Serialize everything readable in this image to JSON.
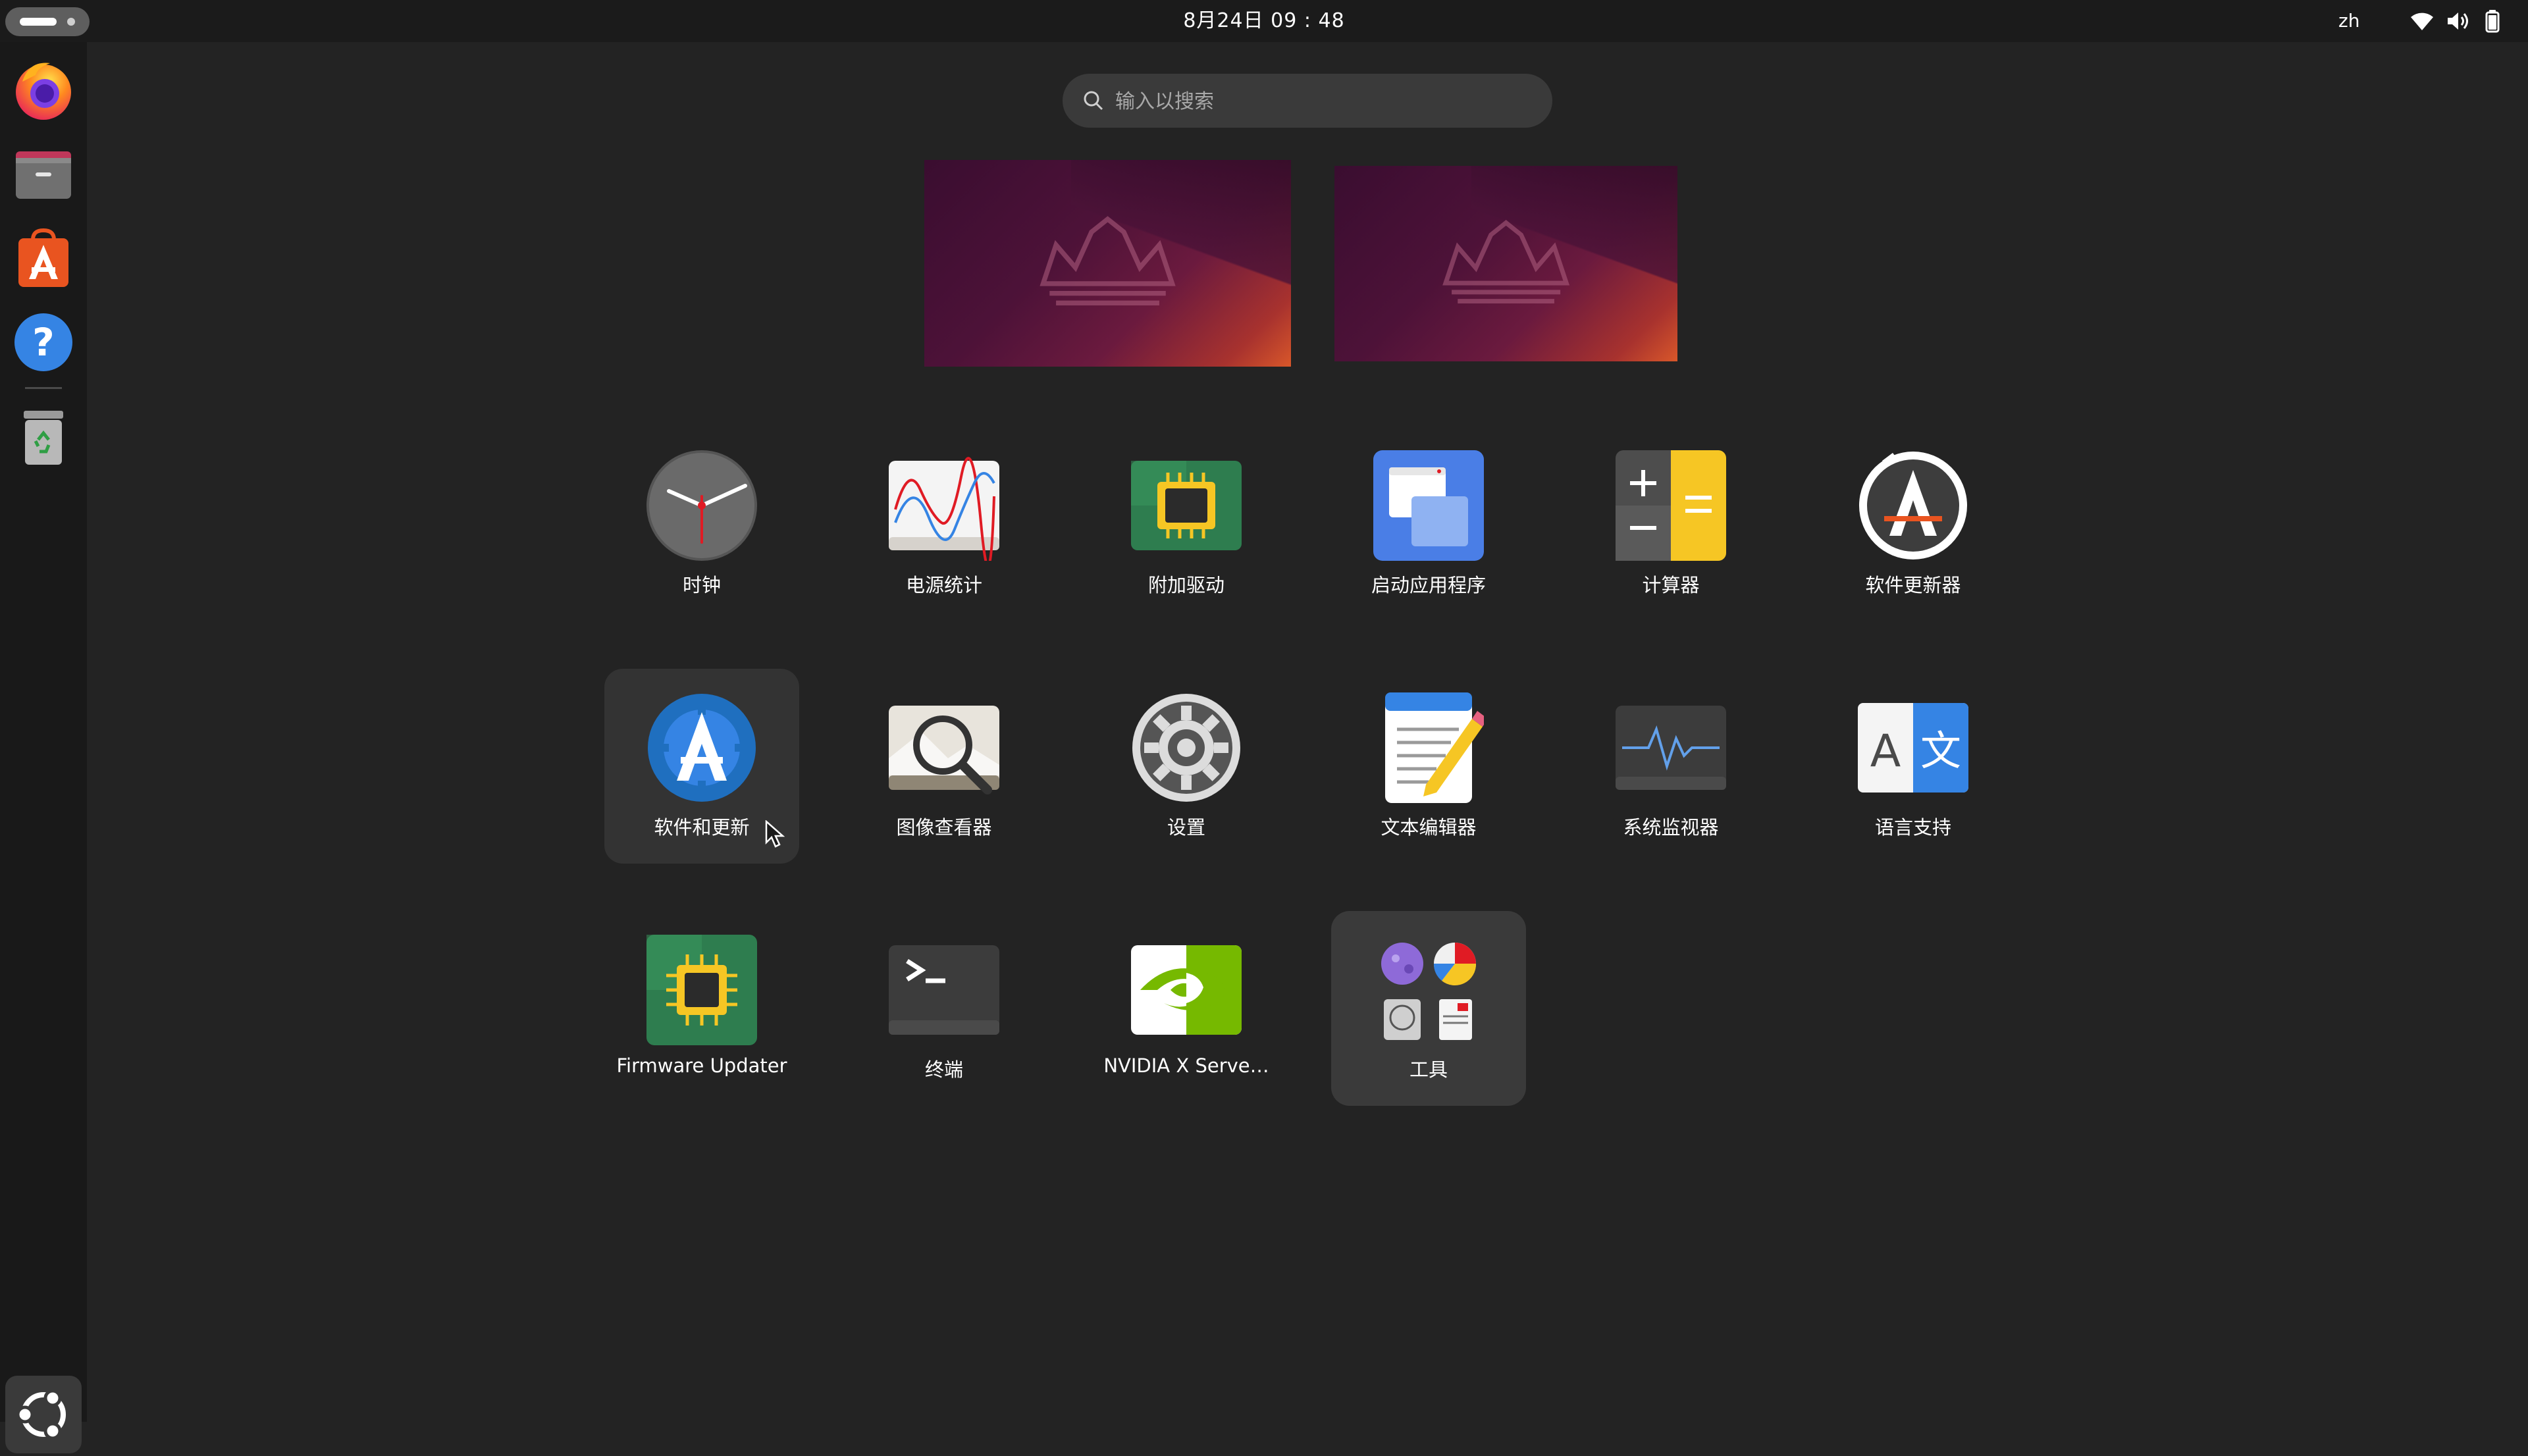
{
  "topbar": {
    "clock": "8月24日 09 : 48",
    "language": "zh",
    "tray_icons": [
      "wifi-icon",
      "volume-icon",
      "battery-icon"
    ]
  },
  "dock": {
    "items": [
      {
        "name": "Firefox",
        "icon": "firefox-icon"
      },
      {
        "name": "Files",
        "icon": "files-icon"
      },
      {
        "name": "App Center",
        "icon": "app-center-icon"
      },
      {
        "name": "Help",
        "icon": "help-icon"
      },
      {
        "name": "Trash",
        "icon": "trash-icon"
      }
    ],
    "show_apps_icon": "show-apps-icon"
  },
  "search": {
    "placeholder": "输入以搜索",
    "value": ""
  },
  "apps": [
    {
      "label": "时钟",
      "icon": "clock-icon"
    },
    {
      "label": "电源统计",
      "icon": "power-statistics-icon"
    },
    {
      "label": "附加驱动",
      "icon": "additional-drivers-icon"
    },
    {
      "label": "启动应用程序",
      "icon": "startup-applications-icon"
    },
    {
      "label": "计算器",
      "icon": "calculator-icon"
    },
    {
      "label": "软件更新器",
      "icon": "software-updater-icon"
    },
    {
      "label": "软件和更新",
      "icon": "software-and-updates-icon"
    },
    {
      "label": "图像查看器",
      "icon": "image-viewer-icon"
    },
    {
      "label": "设置",
      "icon": "settings-icon"
    },
    {
      "label": "文本编辑器",
      "icon": "text-editor-icon"
    },
    {
      "label": "系统监视器",
      "icon": "system-monitor-icon"
    },
    {
      "label": "语言支持",
      "icon": "language-support-icon"
    },
    {
      "label": "Firmware Updater",
      "icon": "firmware-updater-icon"
    },
    {
      "label": "终端",
      "icon": "terminal-icon"
    },
    {
      "label": "NVIDIA X Serve…",
      "icon": "nvidia-icon"
    },
    {
      "label": "工具",
      "icon": "utilities-folder-icon"
    }
  ],
  "colors": {
    "background": "#232323",
    "topbar": "#1b1b1b",
    "dock": "#191919",
    "hover_tile": "#333333",
    "accent_orange": "#e95420"
  }
}
